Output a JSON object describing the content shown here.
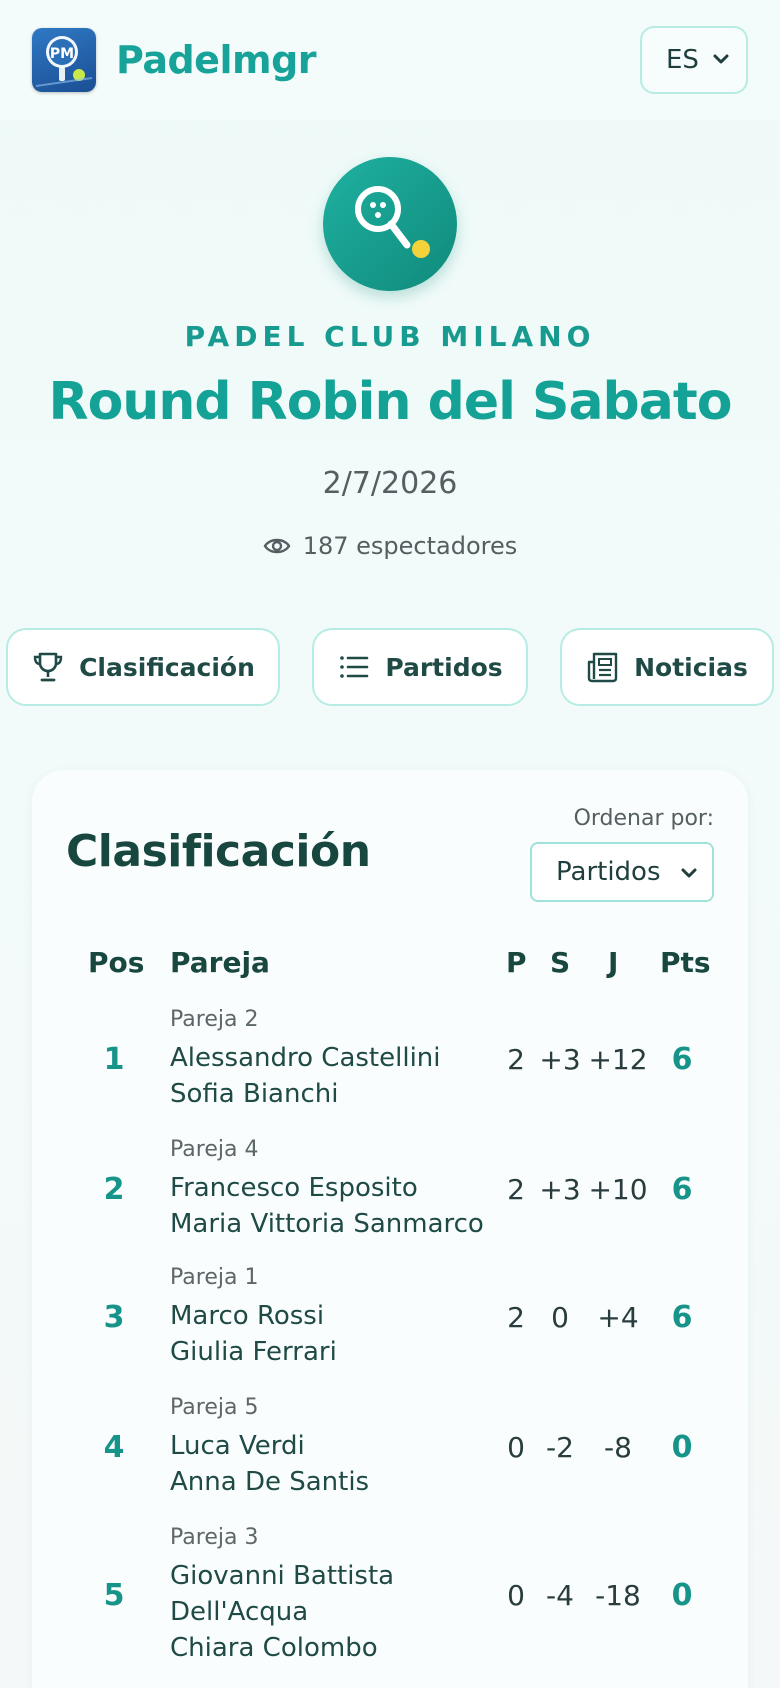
{
  "header": {
    "app_name": "Padelmgr",
    "logo_text": "PM",
    "language": "ES"
  },
  "hero": {
    "club": "PADEL CLUB MILANO",
    "title": "Round Robin del Sabato",
    "date": "2/7/2026",
    "viewers": "187 espectadores"
  },
  "tabs": [
    {
      "label": "Clasificación",
      "icon": "trophy-icon"
    },
    {
      "label": "Partidos",
      "icon": "list-icon"
    },
    {
      "label": "Noticias",
      "icon": "newspaper-icon"
    }
  ],
  "standings": {
    "title": "Clasificación",
    "sort_label": "Ordenar por:",
    "sort_value": "Partidos",
    "columns": [
      "Pos",
      "Pareja",
      "P",
      "S",
      "J",
      "Pts"
    ],
    "rows": [
      {
        "pos": "1",
        "pair": "Pareja 2",
        "players": [
          "Alessandro Castellini",
          "Sofia Bianchi"
        ],
        "p": "2",
        "s": "+3",
        "j": "+12",
        "pts": "6"
      },
      {
        "pos": "2",
        "pair": "Pareja 4",
        "players": [
          "Francesco Esposito",
          "Maria Vittoria Sanmarco"
        ],
        "p": "2",
        "s": "+3",
        "j": "+10",
        "pts": "6"
      },
      {
        "pos": "3",
        "pair": "Pareja 1",
        "players": [
          "Marco Rossi",
          "Giulia Ferrari"
        ],
        "p": "2",
        "s": "0",
        "j": "+4",
        "pts": "6"
      },
      {
        "pos": "4",
        "pair": "Pareja 5",
        "players": [
          "Luca Verdi",
          "Anna De Santis"
        ],
        "p": "0",
        "s": "-2",
        "j": "-8",
        "pts": "0"
      },
      {
        "pos": "5",
        "pair": "Pareja 3",
        "players": [
          "Giovanni Battista",
          "Dell'Acqua",
          "Chiara Colombo"
        ],
        "p": "0",
        "s": "-4",
        "j": "-18",
        "pts": "0"
      }
    ]
  },
  "colors": {
    "accent": "#17a29a",
    "dark": "#18473f",
    "border": "#b7ece4"
  }
}
